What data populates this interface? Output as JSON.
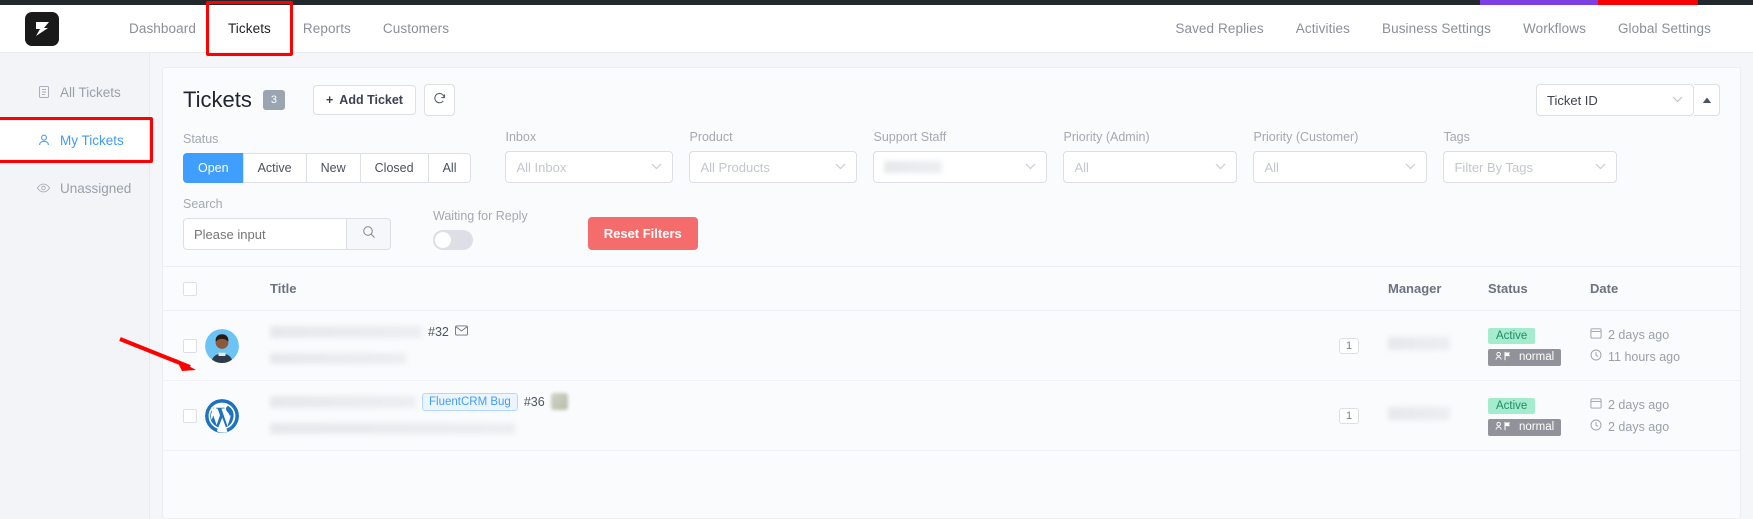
{
  "top_strip": {
    "colors": [
      "#23282d",
      "#7b3fe4",
      "#f60000"
    ]
  },
  "header": {
    "logo_name": "fluent-support-logo",
    "nav_left": [
      {
        "label": "Dashboard",
        "active": false
      },
      {
        "label": "Tickets",
        "active": true,
        "highlighted": true
      },
      {
        "label": "Reports",
        "active": false
      },
      {
        "label": "Customers",
        "active": false
      }
    ],
    "nav_right": [
      {
        "label": "Saved Replies"
      },
      {
        "label": "Activities"
      },
      {
        "label": "Business Settings"
      },
      {
        "label": "Workflows"
      },
      {
        "label": "Global Settings"
      }
    ]
  },
  "sidebar": {
    "items": [
      {
        "label": "All Tickets",
        "icon": "document-icon",
        "selected": false
      },
      {
        "label": "My Tickets",
        "icon": "user-icon",
        "selected": true,
        "highlighted": true
      },
      {
        "label": "Unassigned",
        "icon": "eye-icon",
        "selected": false
      }
    ]
  },
  "main": {
    "title": "Tickets",
    "count": "3",
    "add_ticket_label": "Add Ticket",
    "add_ticket_plus": "+",
    "refresh_icon": "refresh-icon",
    "sort_select_value": "Ticket ID",
    "sort_direction_icon": "sort-ascending-icon"
  },
  "filters": {
    "status": {
      "label": "Status",
      "options": [
        "Open",
        "Active",
        "New",
        "Closed",
        "All"
      ],
      "selected": "Open"
    },
    "inbox": {
      "label": "Inbox",
      "value": "All Inbox"
    },
    "product": {
      "label": "Product",
      "value": "All Products"
    },
    "support_staff": {
      "label": "Support Staff",
      "value": ""
    },
    "priority_admin": {
      "label": "Priority (Admin)",
      "value": "All"
    },
    "priority_customer": {
      "label": "Priority (Customer)",
      "value": "All"
    },
    "tags": {
      "label": "Tags",
      "value": "Filter By Tags"
    },
    "search": {
      "label": "Search",
      "placeholder": "Please input",
      "value": "",
      "icon": "search-icon"
    },
    "waiting_for_reply": {
      "label": "Waiting for Reply",
      "on": false
    },
    "reset_label": "Reset Filters"
  },
  "table": {
    "columns": [
      "Title",
      "Manager",
      "Status",
      "Date"
    ],
    "rows": [
      {
        "avatar": "user-photo-avatar",
        "title_redacted": true,
        "tag": null,
        "ticket_id": "#32",
        "envelope_icon": "envelope-icon",
        "emoji": null,
        "manager_count": "1",
        "manager_redacted": true,
        "status": "Active",
        "priority": "normal",
        "date_created": "2 days ago",
        "date_updated": "11 hours ago"
      },
      {
        "avatar": "wordpress-logo-avatar",
        "title_redacted": true,
        "tag": "FluentCRM Bug",
        "ticket_id": "#36",
        "envelope_icon": null,
        "emoji": "emoji-icon",
        "manager_count": "1",
        "manager_redacted": true,
        "status": "Active",
        "priority": "normal",
        "date_created": "2 days ago",
        "date_updated": "2 days ago"
      }
    ]
  },
  "annotation": {
    "arrow": "red-arrow-pointing-to-first-row"
  }
}
